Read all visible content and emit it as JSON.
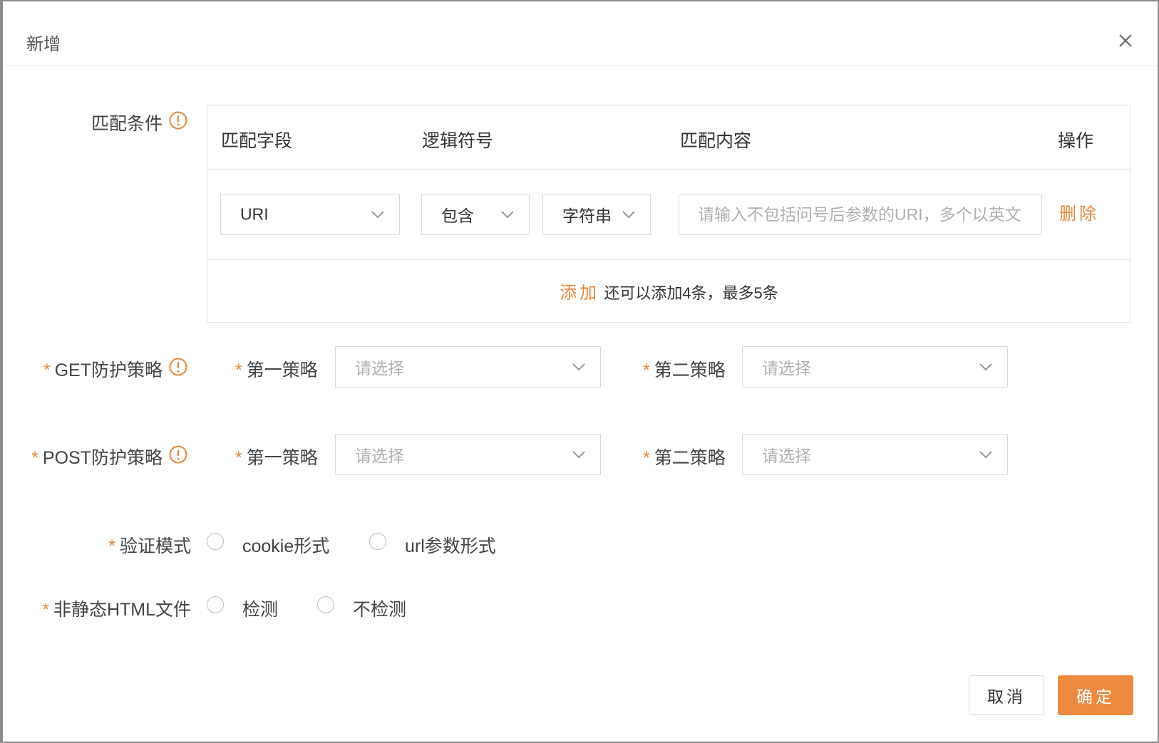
{
  "dialog": {
    "title": "新增"
  },
  "match": {
    "label": "匹配条件",
    "headers": {
      "field": "匹配字段",
      "logic": "逻辑符号",
      "content": "匹配内容",
      "action": "操作"
    },
    "row": {
      "field_value": "URI",
      "logic_value": "包含",
      "type_value": "字符串",
      "content_placeholder": "请输入不包括问号后参数的URI，多个以英文",
      "delete_label": "删除"
    },
    "add_label": "添加",
    "add_hint": "还可以添加4条，最多5条"
  },
  "get_policy": {
    "label": "GET防护策略",
    "first_label": "第一策略",
    "first_placeholder": "请选择",
    "second_label": "第二策略",
    "second_placeholder": "请选择"
  },
  "post_policy": {
    "label": "POST防护策略",
    "first_label": "第一策略",
    "first_placeholder": "请选择",
    "second_label": "第二策略",
    "second_placeholder": "请选择"
  },
  "verify_mode": {
    "label": "验证模式",
    "options": [
      "cookie形式",
      "url参数形式"
    ]
  },
  "non_static_html": {
    "label": "非静态HTML文件",
    "options": [
      "检测",
      "不检测"
    ]
  },
  "footer": {
    "cancel": "取消",
    "confirm": "确定"
  },
  "colors": {
    "accent": "#ed8a3f",
    "required": "#e8873b",
    "border": "#d9d9d9"
  },
  "icons": {
    "close": "close-icon",
    "info": "info-circle-icon",
    "dropdown": "chevron-down-icon"
  }
}
